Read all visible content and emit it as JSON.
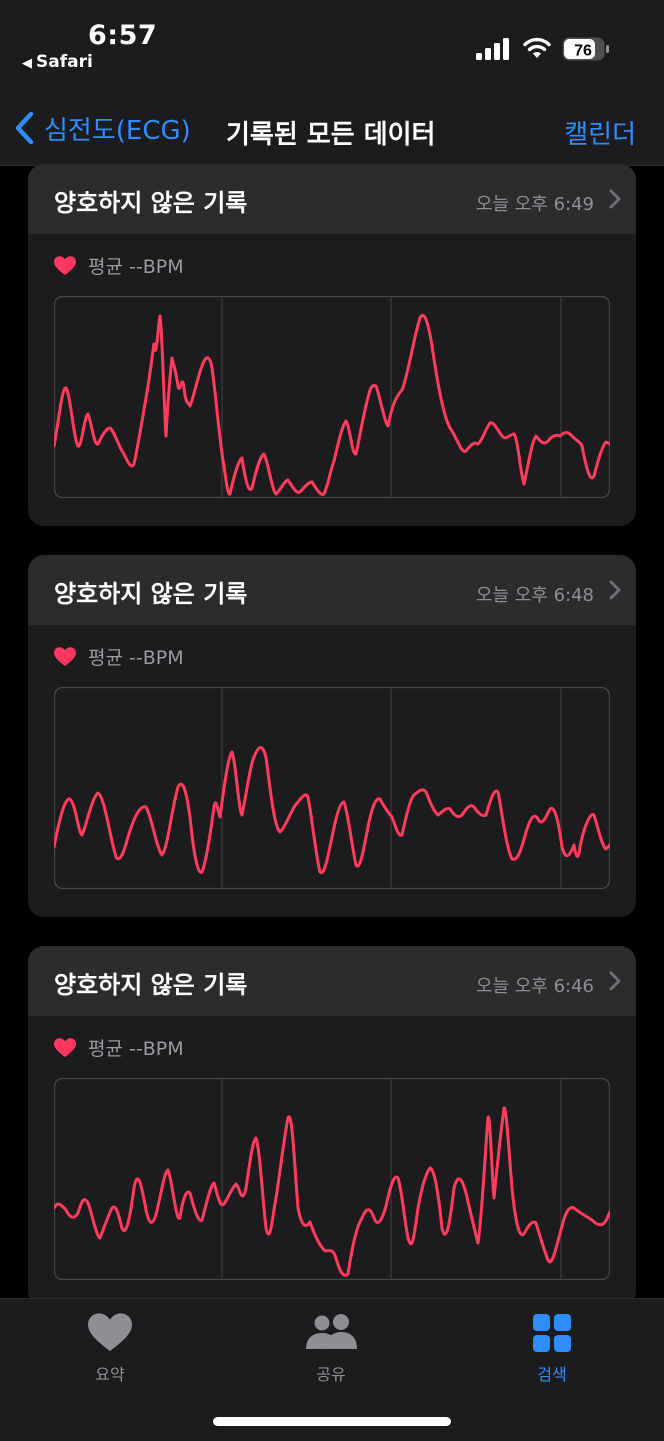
{
  "status_bar": {
    "time": "6:57",
    "back_app": "Safari",
    "battery": "76"
  },
  "nav": {
    "back_label": "심전도(ECG)",
    "title": "기록된 모든 데이터",
    "right_label": "캘린더"
  },
  "records": [
    {
      "title": "양호하지 않은 기록",
      "time": "오늘 오후 6:49",
      "bpm": "평균 --BPM"
    },
    {
      "title": "양호하지 않은 기록",
      "time": "오늘 오후 6:48",
      "bpm": "평균 --BPM"
    },
    {
      "title": "양호하지 않은 기록",
      "time": "오늘 오후 6:46",
      "bpm": "평균 --BPM"
    }
  ],
  "tabs": [
    {
      "label": "요약",
      "icon": "heart-icon",
      "active": false
    },
    {
      "label": "공유",
      "icon": "people-icon",
      "active": false
    },
    {
      "label": "검색",
      "icon": "grid-icon",
      "active": true
    }
  ],
  "colors": {
    "accent": "#2f8cff",
    "ecg": "#ff3b5c",
    "heart": "#ff375f",
    "inactive": "#8e8e93"
  }
}
